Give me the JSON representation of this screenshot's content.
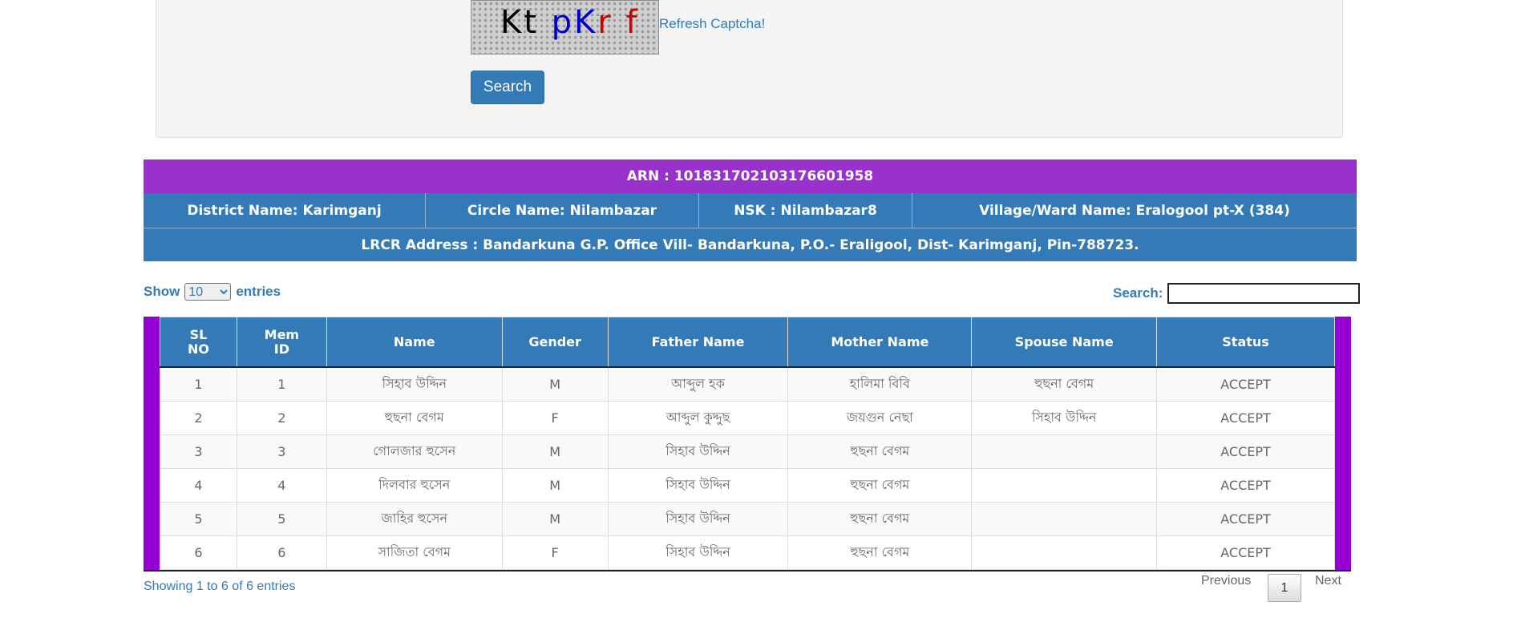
{
  "captcha": {
    "characters": [
      {
        "char": "K",
        "color": "#000000"
      },
      {
        "char": "t",
        "color": "#000000"
      },
      {
        "char": " ",
        "color": "#000000"
      },
      {
        "char": "p",
        "color": "#0000cc"
      },
      {
        "char": "K",
        "color": "#0000cc"
      },
      {
        "char": "r",
        "color": "#cc0000"
      },
      {
        "char": " ",
        "color": "#000000"
      },
      {
        "char": "f",
        "color": "#cc0000"
      }
    ],
    "refresh_label": "Refresh Captcha!"
  },
  "form": {
    "search_button": "Search"
  },
  "info": {
    "arn": "ARN : 101831702103176601958",
    "district": "District Name: Karimganj",
    "circle": "Circle Name: Nilambazar",
    "nsk": "NSK : Nilambazar8",
    "village": "Village/Ward Name: Eralogool pt-X (384)",
    "lrcr": "LRCR Address : Bandarkuna G.P. Office Vill- Bandarkuna, P.O.- Eraligool, Dist- Karimganj, Pin-788723."
  },
  "controls": {
    "show_label": "Show",
    "entries_label": "entries",
    "entries_value": "10",
    "entries_options": [
      "10"
    ],
    "search_label": "Search:",
    "search_value": ""
  },
  "table": {
    "headers": [
      {
        "line1": "SL",
        "line2": "NO"
      },
      {
        "line1": "Mem",
        "line2": "ID"
      },
      {
        "line1": "Name",
        "line2": ""
      },
      {
        "line1": "Gender",
        "line2": ""
      },
      {
        "line1": "Father Name",
        "line2": ""
      },
      {
        "line1": "Mother Name",
        "line2": ""
      },
      {
        "line1": "Spouse Name",
        "line2": ""
      },
      {
        "line1": "Status",
        "line2": ""
      }
    ],
    "rows": [
      [
        "1",
        "1",
        "সিহাব উদ্দিন",
        "M",
        "আব্দুল হক",
        "হালিমা বিবি",
        "হুছনা বেগম",
        "ACCEPT"
      ],
      [
        "2",
        "2",
        "হুছনা বেগম",
        "F",
        "আব্দুল কুদ্দুছ",
        "জয়গুন নেছা",
        "সিহাব উদ্দিন",
        "ACCEPT"
      ],
      [
        "3",
        "3",
        "গোলজার হুসেন",
        "M",
        "সিহাব উদ্দিন",
        "হুছনা বেগম",
        "",
        "ACCEPT"
      ],
      [
        "4",
        "4",
        "দিলবার হুসেন",
        "M",
        "সিহাব উদ্দিন",
        "হুছনা বেগম",
        "",
        "ACCEPT"
      ],
      [
        "5",
        "5",
        "জাহির হুসেন",
        "M",
        "সিহাব উদ্দিন",
        "হুছনা বেগম",
        "",
        "ACCEPT"
      ],
      [
        "6",
        "6",
        "সাজিতা বেগম",
        "F",
        "সিহাব উদ্দিন",
        "হুছনা বেগম",
        "",
        "ACCEPT"
      ]
    ]
  },
  "footer": {
    "showing": "Showing 1 to 6 of 6 entries",
    "previous": "Previous",
    "page": "1",
    "next": "Next"
  }
}
